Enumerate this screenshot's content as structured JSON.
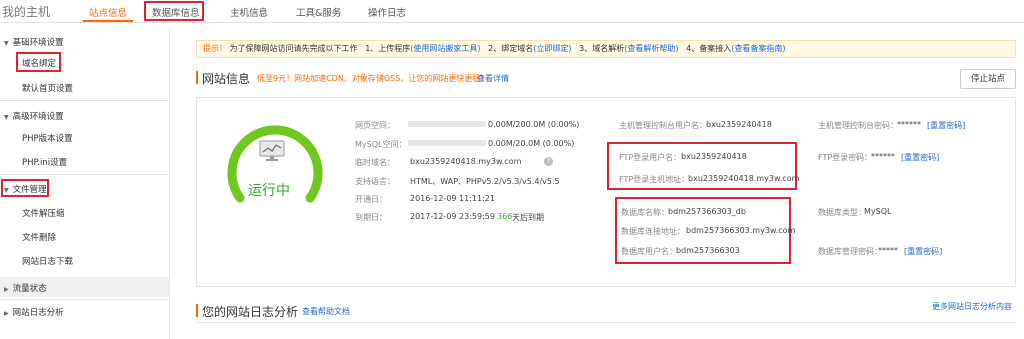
{
  "header": {
    "brand": "我的主机",
    "nav": [
      {
        "label": "站点信息"
      },
      {
        "label": "数据库信息"
      },
      {
        "label": "主机信息"
      },
      {
        "label": "工具&服务"
      },
      {
        "label": "操作日志"
      }
    ]
  },
  "sidebar": {
    "section1": {
      "title": "基础环境设置",
      "items": [
        "域名绑定",
        "默认首页设置"
      ]
    },
    "section2": {
      "title": "高级环境设置",
      "items": [
        "PHP版本设置",
        "PHP.ini设置"
      ]
    },
    "section3": {
      "title": "文件管理",
      "items": [
        "文件解压缩",
        "文件删除",
        "网站日志下载"
      ]
    },
    "section4": {
      "title": "流量状态"
    },
    "section5": {
      "title": "网站日志分析"
    }
  },
  "notice": {
    "tip": "提示！",
    "text": "为了保障网站访问请先完成以下工作",
    "step1": "1、上传程序",
    "step1_link": "(使用网站搬家工具)",
    "step2": "2、绑定域名",
    "step2_link": "(立即绑定)",
    "step3": "3、域名解析",
    "step3_link": "(查看解析帮助)",
    "step4": "4、备案接入",
    "step4_link": "(查看备案指南)"
  },
  "site_panel": {
    "title": "网站信息",
    "promo": "低至9元！网站加速CDN、对象存储OSS，让您的网站更快更稳！",
    "promo_link": "查看详情",
    "stop_button": "停止站点",
    "status": "运行中",
    "status_color": "#3aa63a",
    "web_space_label": "网页空间：",
    "web_space_value": "0.00M/200.0M (0.00%)",
    "web_space_fraction": 0,
    "mysql_space_label": "MySQL空间：",
    "mysql_space_value": "0.00M/20.0M (0.00%)",
    "mysql_space_fraction": 0,
    "temp_domain_label": "临时域名：",
    "temp_domain_value": "bxu2359240418.my3w.com",
    "lang_label": "支持语言：",
    "lang_value": "HTML、WAP、PHPv5.2/v5.3/v5.4/v5.5",
    "open_label": "开通日：",
    "open_value": "2016-12-09 11:11:21",
    "expire_label": "到期日：",
    "expire_value": "2017-12-09 23:59:59",
    "expire_days": "366",
    "expire_suffix": "天后到期",
    "mgmt_user_label": "主机管理控制台用户名：",
    "mgmt_user_value": "bxu2359240418",
    "mgmt_pwd_label": "主机管理控制台密码：",
    "mgmt_pwd_value": "******",
    "reset_pwd": "[重置密码]",
    "ftp_user_label": "FTP登录用户名：",
    "ftp_user_value": "bxu2359240418",
    "ftp_pwd_label": "FTP登录密码：",
    "ftp_pwd_value": "******",
    "ftp_host_label": "FTP登录主机地址：",
    "ftp_host_value": "bxu2359240418.my3w.com",
    "db_name_label": "数据库名称：",
    "db_name_value": "bdm257366303_db",
    "db_type_label": "数据库类型：",
    "db_type_value": "MySQL",
    "db_conn_label": "数据库连接地址：",
    "db_conn_value": "bdm257366303.my3w.com",
    "db_user_label": "数据库用户名：",
    "db_user_value": "bdm257366303",
    "db_pwd_label": "数据库管理密码：",
    "db_pwd_value": "*****"
  },
  "log_panel": {
    "title": "您的网站日志分析",
    "help_link": "查看帮助文档",
    "more_link": "更多网站日志分析内容"
  },
  "colors": {
    "accent": "#ff6a00",
    "highlight": "#e0232f",
    "link": "#1e6bd6"
  }
}
